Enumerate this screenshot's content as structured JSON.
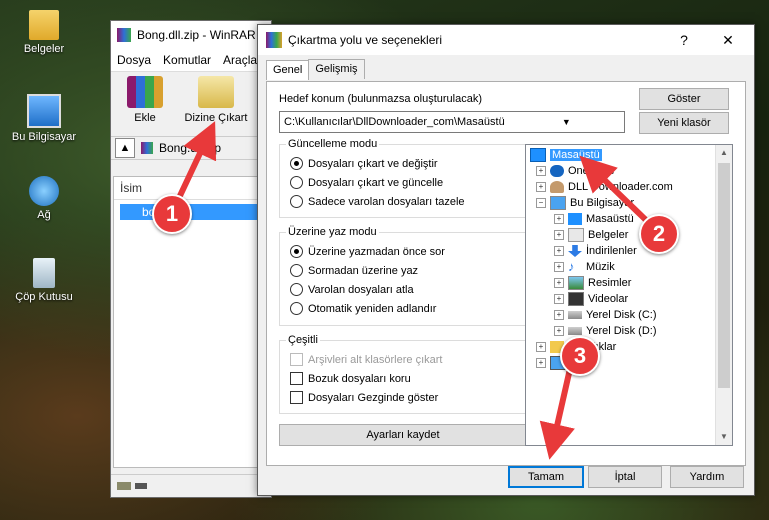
{
  "desktop": {
    "icons": [
      {
        "label": "Belgeler",
        "icon": "folder-icon"
      },
      {
        "label": "Bu Bilgisayar",
        "icon": "computer-icon"
      },
      {
        "label": "Ağ",
        "icon": "network-icon"
      },
      {
        "label": "Çöp Kutusu",
        "icon": "recycle-bin-icon"
      }
    ]
  },
  "winrar": {
    "title": "Bong.dll.zip - WinRAR",
    "menu": [
      "Dosya",
      "Komutlar",
      "Araçlar"
    ],
    "tools": [
      {
        "label": "Ekle"
      },
      {
        "label": "Dizine Çıkart"
      }
    ],
    "path": "Bong.dll.zip",
    "column_header": "İsim",
    "file_row": "bong.dll"
  },
  "dialog": {
    "title": "Çıkartma yolu ve seçenekleri",
    "help": "?",
    "close": "✕",
    "tabs": [
      "Genel",
      "Gelişmiş"
    ],
    "dest_label": "Hedef konum (bulunmazsa oluşturulacak)",
    "dest_value": "C:\\Kullanıcılar\\DllDownloader_com\\Masaüstü",
    "show_btn": "Göster",
    "new_folder_btn": "Yeni klasör",
    "update_mode": {
      "title": "Güncelleme modu",
      "options": [
        "Dosyaları çıkart ve değiştir",
        "Dosyaları çıkart ve güncelle",
        "Sadece varolan dosyaları tazele"
      ],
      "selected": 0
    },
    "overwrite_mode": {
      "title": "Üzerine yaz modu",
      "options": [
        "Üzerine yazmadan önce sor",
        "Sormadan üzerine yaz",
        "Varolan dosyaları atla",
        "Otomatik yeniden adlandır"
      ],
      "selected": 0
    },
    "misc": {
      "title": "Çeşitli",
      "options": [
        {
          "label": "Arşivleri alt klasörlere çıkart",
          "disabled": true
        },
        {
          "label": "Bozuk dosyaları koru",
          "disabled": false
        },
        {
          "label": "Dosyaları Gezginde göster",
          "disabled": false
        }
      ]
    },
    "save_btn": "Ayarları kaydet",
    "tree": [
      {
        "label": "Masaüstü",
        "level": 0,
        "icon": "desktop-icon",
        "selected": true
      },
      {
        "label": "OneDrive",
        "level": 1,
        "icon": "cloud-icon"
      },
      {
        "label": "DLL Downloader.com",
        "level": 1,
        "icon": "user-icon"
      },
      {
        "label": "Bu Bilgisayar",
        "level": 1,
        "icon": "computer-icon",
        "expanded": true
      },
      {
        "label": "Masaüstü",
        "level": 2,
        "icon": "desktop-icon"
      },
      {
        "label": "Belgeler",
        "level": 2,
        "icon": "documents-icon"
      },
      {
        "label": "İndirilenler",
        "level": 2,
        "icon": "download-icon"
      },
      {
        "label": "Müzik",
        "level": 2,
        "icon": "music-icon"
      },
      {
        "label": "Resimler",
        "level": 2,
        "icon": "pictures-icon"
      },
      {
        "label": "Videolar",
        "level": 2,
        "icon": "videos-icon"
      },
      {
        "label": "Yerel Disk (C:)",
        "level": 2,
        "icon": "disk-icon"
      },
      {
        "label": "Yerel Disk (D:)",
        "level": 2,
        "icon": "disk-icon"
      },
      {
        "label": "Kitaplıklar",
        "level": 1,
        "icon": "library-icon"
      },
      {
        "label": "Ağ",
        "level": 1,
        "icon": "network-icon"
      }
    ],
    "ok_btn": "Tamam",
    "cancel_btn": "İptal",
    "help_btn": "Yardım"
  },
  "annotations": [
    "1",
    "2",
    "3"
  ],
  "colors": {
    "accent": "#0078d7",
    "selection": "#3399ff",
    "annotation": "#e8393a"
  }
}
